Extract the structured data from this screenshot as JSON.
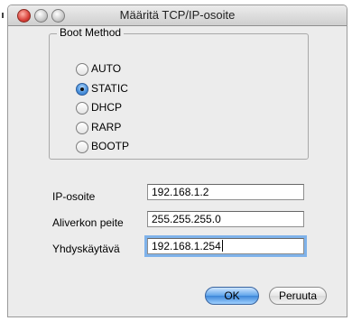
{
  "window": {
    "title": "Määritä TCP/IP-osoite"
  },
  "boot_method": {
    "legend": "Boot Method",
    "selected": "STATIC",
    "options": [
      {
        "label": "AUTO",
        "checked": false
      },
      {
        "label": "STATIC",
        "checked": true
      },
      {
        "label": "DHCP",
        "checked": false
      },
      {
        "label": "RARP",
        "checked": false
      },
      {
        "label": "BOOTP",
        "checked": false
      }
    ]
  },
  "fields": [
    {
      "label": "IP-osoite",
      "value": "192.168.1.2"
    },
    {
      "label": "Aliverkon peite",
      "value": "255.255.255.0"
    },
    {
      "label": "Yhdyskäytävä",
      "value": "192.168.1.254"
    }
  ],
  "buttons": {
    "ok": "OK",
    "cancel": "Peruuta"
  }
}
